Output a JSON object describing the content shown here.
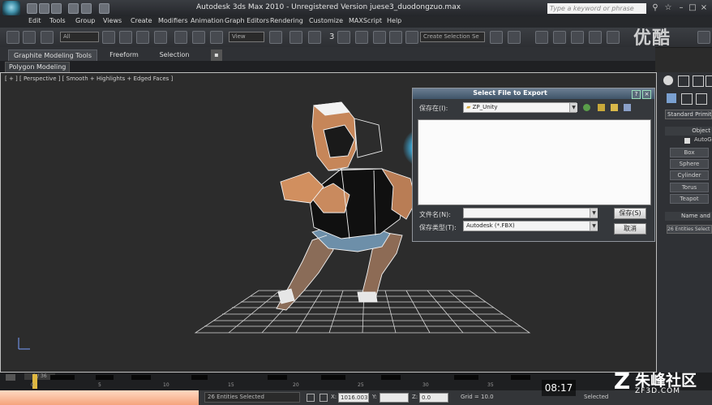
{
  "window": {
    "title": "Autodesk 3ds Max  2010  - Unregistered Version    juese3_duodongzuo.max",
    "search_placeholder": "Type a keyword or phrase"
  },
  "menu": {
    "items": [
      "Edit",
      "Tools",
      "Group",
      "Views",
      "Create",
      "Modifiers",
      "Animation",
      "Graph Editors",
      "Rendering",
      "Customize",
      "MAXScript",
      "Help"
    ]
  },
  "toolbar": {
    "filter_value": "All",
    "view_value": "View",
    "selection_set_value": "Create Selection Se",
    "snap_label": "3"
  },
  "ribbon": {
    "tabs": [
      "Graphite Modeling Tools",
      "Freeform",
      "Selection"
    ],
    "sub_tab": "Polygon Modeling"
  },
  "viewport": {
    "label": "[ + ] [ Perspective ] [ Smooth + Highlights + Edged Faces ]"
  },
  "dialog": {
    "title": "Select File to Export",
    "save_in_label": "保存在(I):",
    "save_in_value": "ZP_Unity",
    "file_name_label": "文件名(N):",
    "file_name_value": "",
    "file_type_label": "保存类型(T):",
    "file_type_value": "Autodesk (*.FBX)",
    "save_button": "保存(S)",
    "cancel_button": "取消",
    "help_glyph": "?",
    "close_glyph": "×"
  },
  "command_panel": {
    "dropdown_value": "Standard Primitiv",
    "rollout_object_type": "Object",
    "autogrid_label": "AutoG",
    "buttons": [
      "Box",
      "Sphere",
      "Cylinder",
      "Torus",
      "Teapot"
    ],
    "rollout_name": "Name and",
    "name_value": "26 Entities Select"
  },
  "timeline": {
    "frame_counter": "0 / 36",
    "ticks": [
      "0",
      "5",
      "10",
      "15",
      "20",
      "25",
      "30",
      "35"
    ]
  },
  "status": {
    "selection": "26 Entities Selected",
    "x_label": "X:",
    "x_value": "1016.003",
    "y_label": "Y:",
    "z_label": "Z:",
    "z_value": "0.0",
    "grid": "Grid = 10.0",
    "auto_key": "Selected"
  },
  "overlay": {
    "video_time": "08:17",
    "watermark_top": "优酷",
    "watermark_logo_glyph": "Z",
    "watermark_name": "朱峰社区",
    "watermark_url": "ZF3D.COM"
  }
}
